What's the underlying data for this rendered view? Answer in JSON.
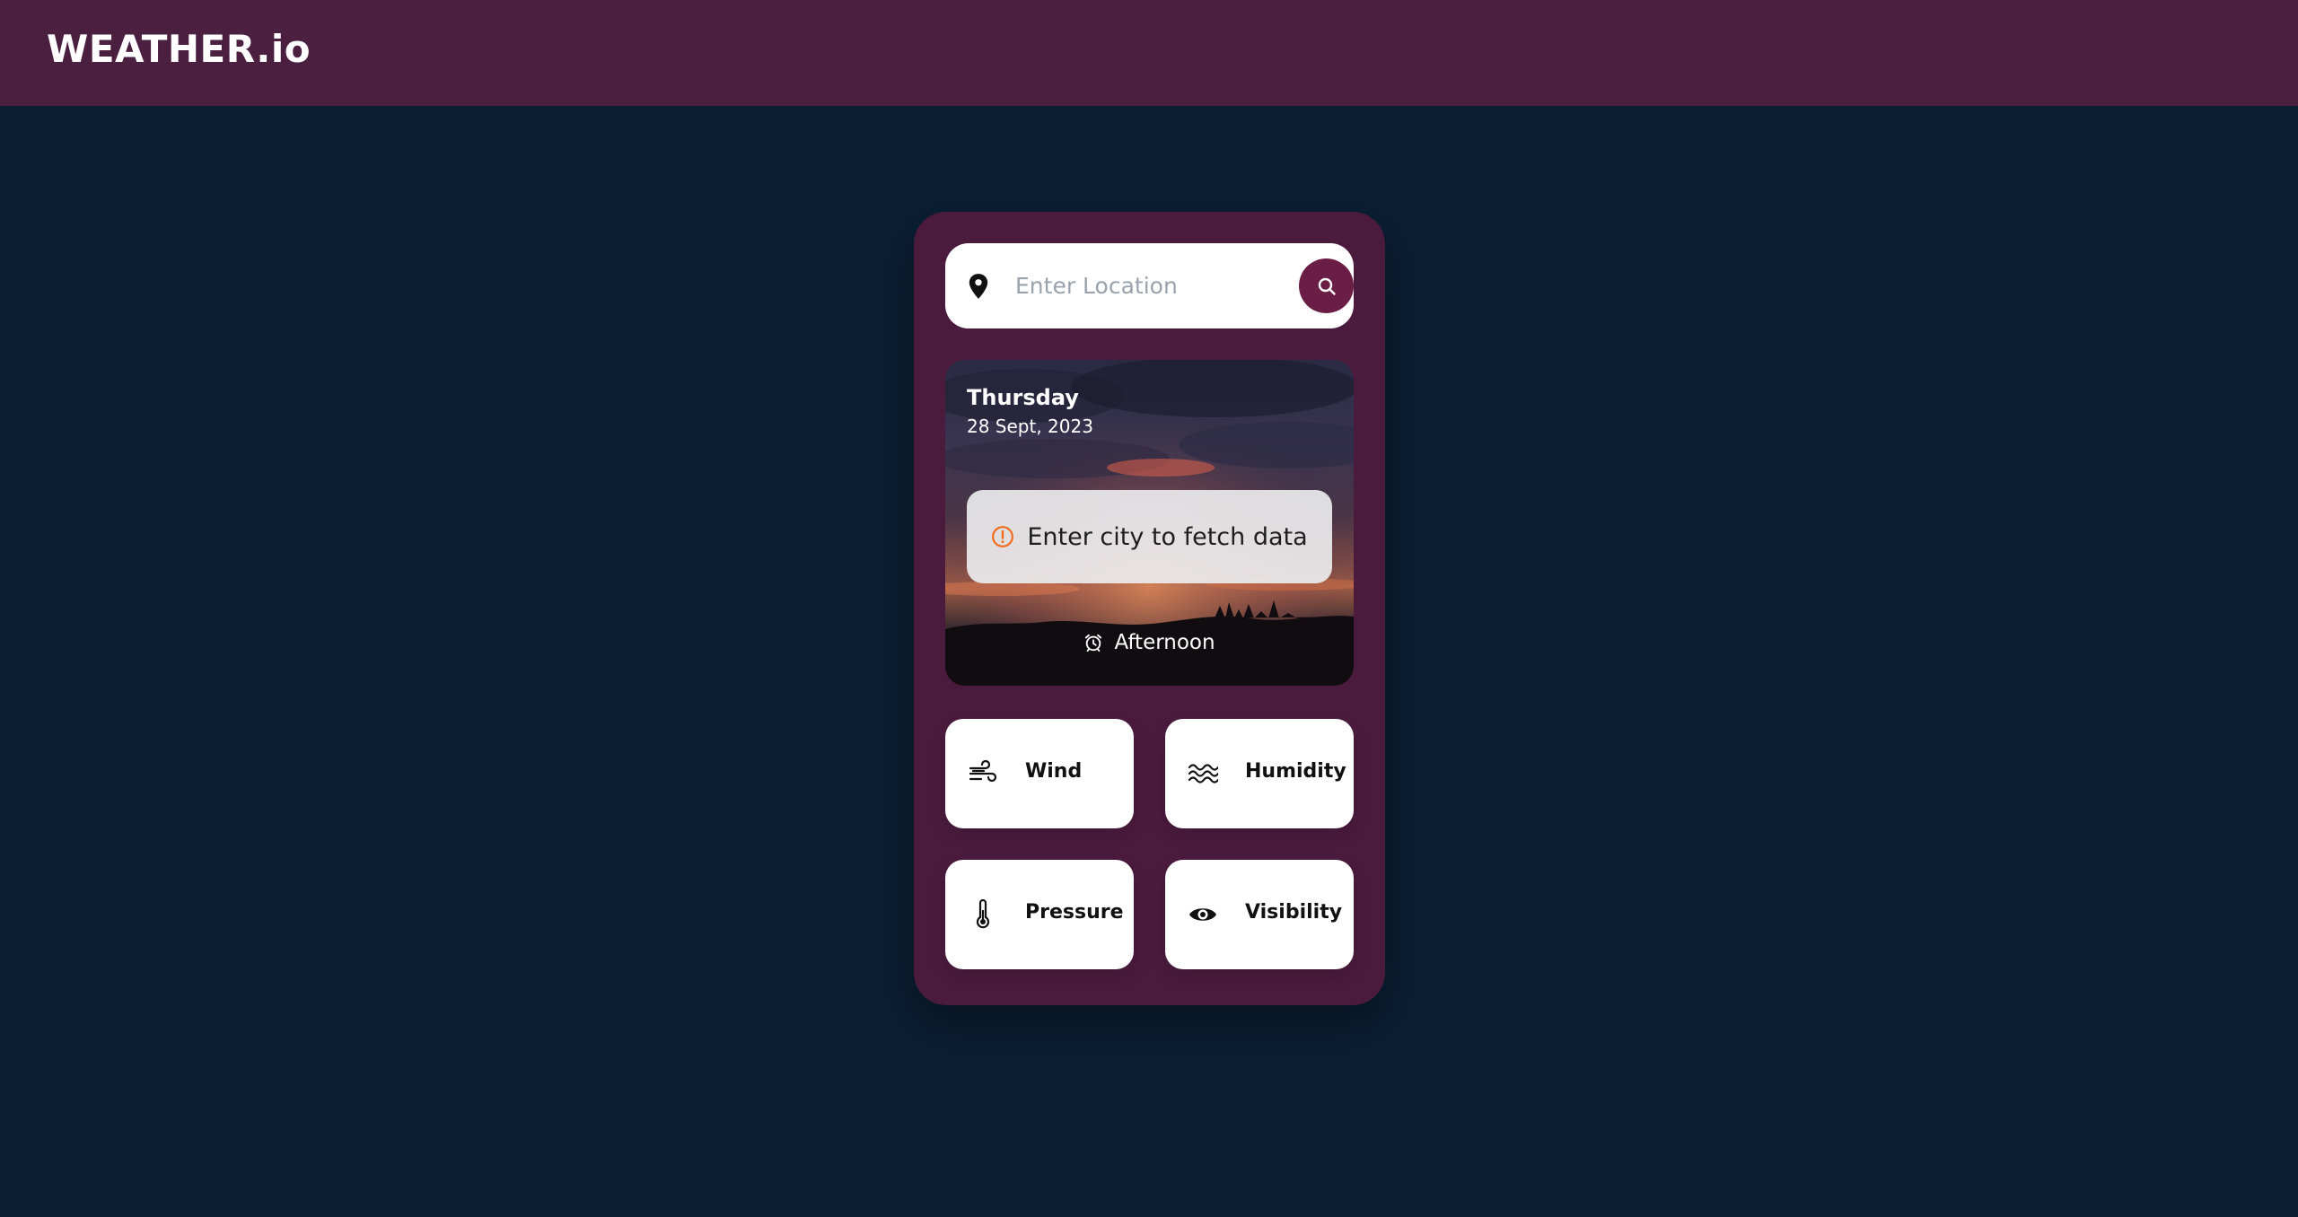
{
  "header": {
    "brand": "WEATHER.io",
    "background": "#4a1f40"
  },
  "search": {
    "placeholder": "Enter Location",
    "value": "",
    "pin_icon": "map-pin-icon",
    "button_icon": "search-icon",
    "button_color": "#6a1d45"
  },
  "hero": {
    "day": "Thursday",
    "date": "28 Sept, 2023",
    "notice": {
      "icon": "alert-circle-icon",
      "icon_color": "#f26a1b",
      "text": "Enter city to fetch data"
    },
    "time_of_day": {
      "icon": "alarm-clock-icon",
      "label": "Afternoon"
    }
  },
  "tiles": [
    {
      "label": "Wind",
      "icon": "wind-icon"
    },
    {
      "label": "Humidity",
      "icon": "waves-icon"
    },
    {
      "label": "Pressure",
      "icon": "thermometer-icon"
    },
    {
      "label": "Visibility",
      "icon": "eye-icon"
    }
  ],
  "colors": {
    "page_background": "#0b1e33",
    "card_background": "#4a1b3d",
    "accent": "#6a1d45"
  }
}
